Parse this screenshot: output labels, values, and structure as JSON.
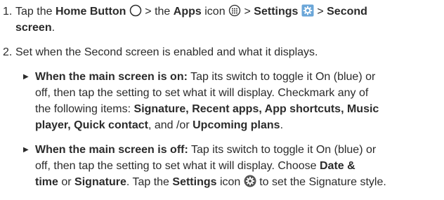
{
  "step1": {
    "number": "1.",
    "tap": "Tap the",
    "home_button": "Home Button",
    "gt1": ">",
    "the": "the",
    "apps": "Apps",
    "icon_word": "icon",
    "gt2": ">",
    "settings": "Settings",
    "gt3": ">",
    "second_screen_a": "Second",
    "second_screen_b": "screen",
    "period": ".",
    "icons": {
      "home": "circle-outline-icon",
      "apps": "apps-grid-icon",
      "settings": "gear-square-icon"
    }
  },
  "step2": {
    "number": "2.",
    "text": "Set when the Second screen is enabled and what it displays."
  },
  "bullet1": {
    "lead": "When the main screen is on:",
    "line1_rest": "Tap its switch to toggle it On (blue) or",
    "line2": "off, then tap the setting to set what it will display. Checkmark any of",
    "line3_pre": "the following items:",
    "items_a": "Signature, Recent apps, App shortcuts, Music",
    "items_b": "player, Quick contact",
    "and_or": ", and /or",
    "upcoming": "Upcoming plans",
    "end": "."
  },
  "bullet2": {
    "lead": "When the main screen is off:",
    "line1_rest": "Tap its switch to toggle it On (blue) or",
    "line2_pre": "off, then tap the setting to set what it will display. Choose",
    "date_time_a": "Date &",
    "date_time_b": "time",
    "or": "or",
    "signature": "Signature",
    "tap_the": ". Tap the",
    "settings": "Settings",
    "icon_to": "icon",
    "rest": "to set the Signature style.",
    "icons": {
      "settings": "gear-circle-icon"
    }
  },
  "colors": {
    "text": "#2b2b2b",
    "gear_blue": "#6aa6d8"
  }
}
